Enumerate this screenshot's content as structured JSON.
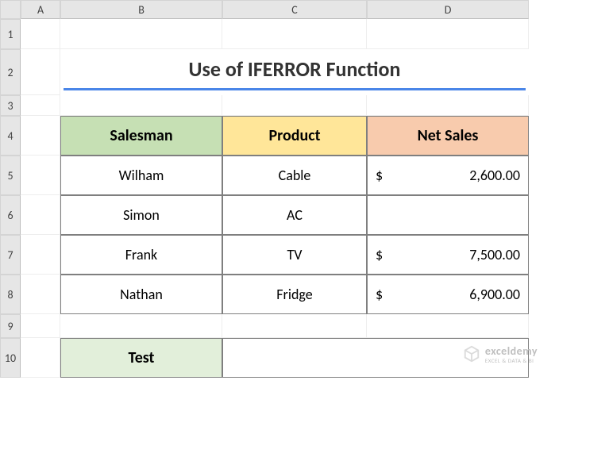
{
  "columns": [
    "A",
    "B",
    "C",
    "D"
  ],
  "rows": [
    "1",
    "2",
    "3",
    "4",
    "5",
    "6",
    "7",
    "8",
    "9",
    "10"
  ],
  "title": "Use of IFERROR Function",
  "headers": {
    "salesman": "Salesman",
    "product": "Product",
    "netsales": "Net Sales"
  },
  "data": [
    {
      "salesman": "Wilham",
      "product": "Cable",
      "currency": "$",
      "netsales": "2,600.00"
    },
    {
      "salesman": "Simon",
      "product": "AC",
      "currency": "",
      "netsales": ""
    },
    {
      "salesman": "Frank",
      "product": "TV",
      "currency": "$",
      "netsales": "7,500.00"
    },
    {
      "salesman": "Nathan",
      "product": "Fridge",
      "currency": "$",
      "netsales": "6,900.00"
    }
  ],
  "test": {
    "label": "Test",
    "value": ""
  },
  "watermark": {
    "brand": "exceldemy",
    "tag": "EXCEL & DATA & BI"
  },
  "chart_data": {
    "type": "table",
    "title": "Use of IFERROR Function",
    "columns": [
      "Salesman",
      "Product",
      "Net Sales"
    ],
    "rows": [
      [
        "Wilham",
        "Cable",
        2600.0
      ],
      [
        "Simon",
        "AC",
        null
      ],
      [
        "Frank",
        "TV",
        7500.0
      ],
      [
        "Nathan",
        "Fridge",
        6900.0
      ]
    ]
  }
}
